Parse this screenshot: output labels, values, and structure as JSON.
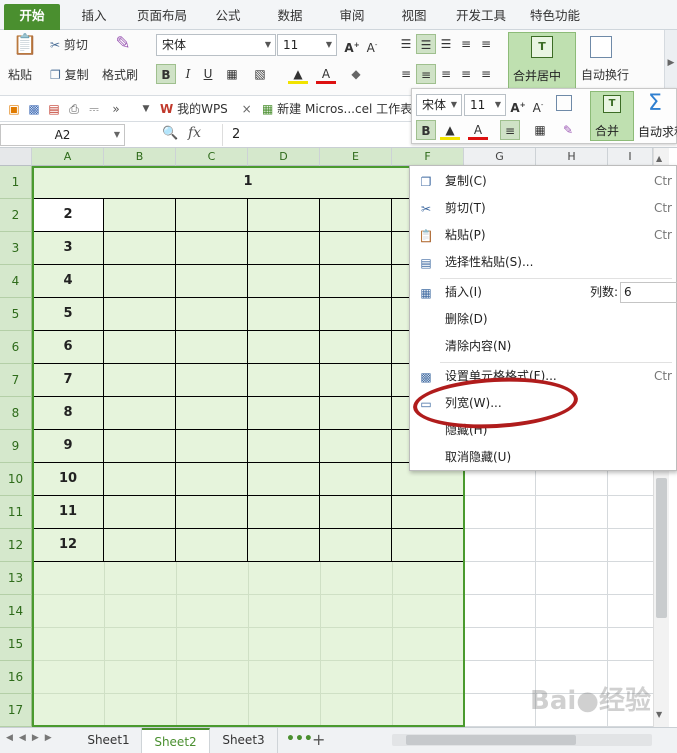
{
  "ribbon_tabs": [
    "开始",
    "插入",
    "页面布局",
    "公式",
    "数据",
    "审阅",
    "视图",
    "开发工具",
    "特色功能"
  ],
  "ribbon": {
    "paste": "粘贴",
    "cut": "剪切",
    "copy": "复制",
    "format_painter": "格式刷",
    "font_name": "宋体",
    "font_size": "11",
    "bold": "B",
    "italic": "I",
    "underline": "U",
    "merge_center": "合并居中",
    "wrap_text": "自动换行"
  },
  "quick_bar": {
    "tab_mywps": "我的WPS",
    "tab_doc": "新建 Micros...cel 工作表"
  },
  "formula_bar": {
    "cell_ref": "A2",
    "fx": "fx",
    "value": "2"
  },
  "columns": [
    "A",
    "B",
    "C",
    "D",
    "E",
    "F",
    "G",
    "H",
    "I"
  ],
  "rows": [
    "1",
    "2",
    "3",
    "4",
    "5",
    "6",
    "7",
    "8",
    "9",
    "10",
    "11",
    "12",
    "13",
    "14",
    "15",
    "16",
    "17"
  ],
  "table": {
    "title": "1",
    "a_values": [
      "2",
      "3",
      "4",
      "5",
      "6",
      "7",
      "8",
      "9",
      "10",
      "11",
      "12"
    ]
  },
  "mini_toolbar": {
    "font_name": "宋体",
    "font_size": "11",
    "bold": "B",
    "merge": "合并",
    "autosum": "自动求和"
  },
  "context_menu": {
    "copy": "复制(C)",
    "copy_shortcut": "Ctr",
    "cut": "剪切(T)",
    "cut_shortcut": "Ctr",
    "paste": "粘贴(P)",
    "paste_shortcut": "Ctr",
    "paste_special": "选择性粘贴(S)...",
    "insert": "插入(I)",
    "columns_label": "列数:",
    "columns_value": "6",
    "delete": "删除(D)",
    "clear": "清除内容(N)",
    "format_cells": "设置单元格格式(F)...",
    "format_shortcut": "Ctr",
    "col_width": "列宽(W)...",
    "hide": "隐藏(H)",
    "unhide": "取消隐藏(U)"
  },
  "sheets": [
    "Sheet1",
    "Sheet2",
    "Sheet3"
  ],
  "active_sheet": "Sheet2",
  "colors": {
    "accent": "#4a8f2f",
    "selection_fill": "#e6f4dc",
    "highlight_oval": "#b01c1c"
  }
}
